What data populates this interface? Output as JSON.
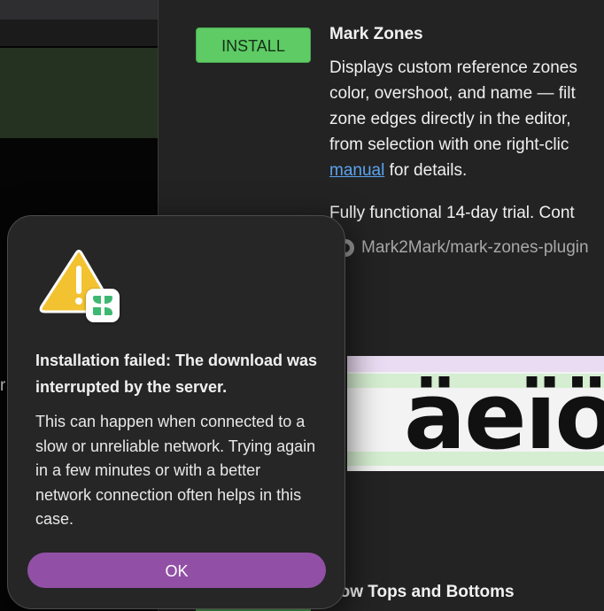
{
  "plugin": {
    "install_label": "INSTALL",
    "title": "Mark Zones",
    "description_lines": [
      "Displays custom reference zones",
      "color, overshoot, and name — filt",
      "zone edges directly in the editor,",
      "from selection with one right-clic"
    ],
    "description_link": "manual",
    "description_tail": " for details.",
    "trial_text": "Fully functional 14-day trial. Cont",
    "repo_link": "Mark2Mark/mark-zones-plugin",
    "preview_glyphs": "äeïö"
  },
  "next_plugin": {
    "title_partial": "how Tops and Bottoms"
  },
  "left_window": {
    "cut_text": "r"
  },
  "alert": {
    "title": "Installation failed: The download was interrupted by the server.",
    "message": "This can happen when connected to a slow or unreliable network. Trying again in a few minutes or with a better network connection often helps in this case.",
    "ok_label": "OK",
    "icon": "warning-triangle-icon",
    "badge_icon": "glyphs-app-icon"
  },
  "colors": {
    "install_green": "#5ecb65",
    "ok_purple": "#9150a6",
    "link_blue": "#5ba3f0",
    "warning_yellow": "#f2c230",
    "glyphs_green": "#3db870"
  }
}
